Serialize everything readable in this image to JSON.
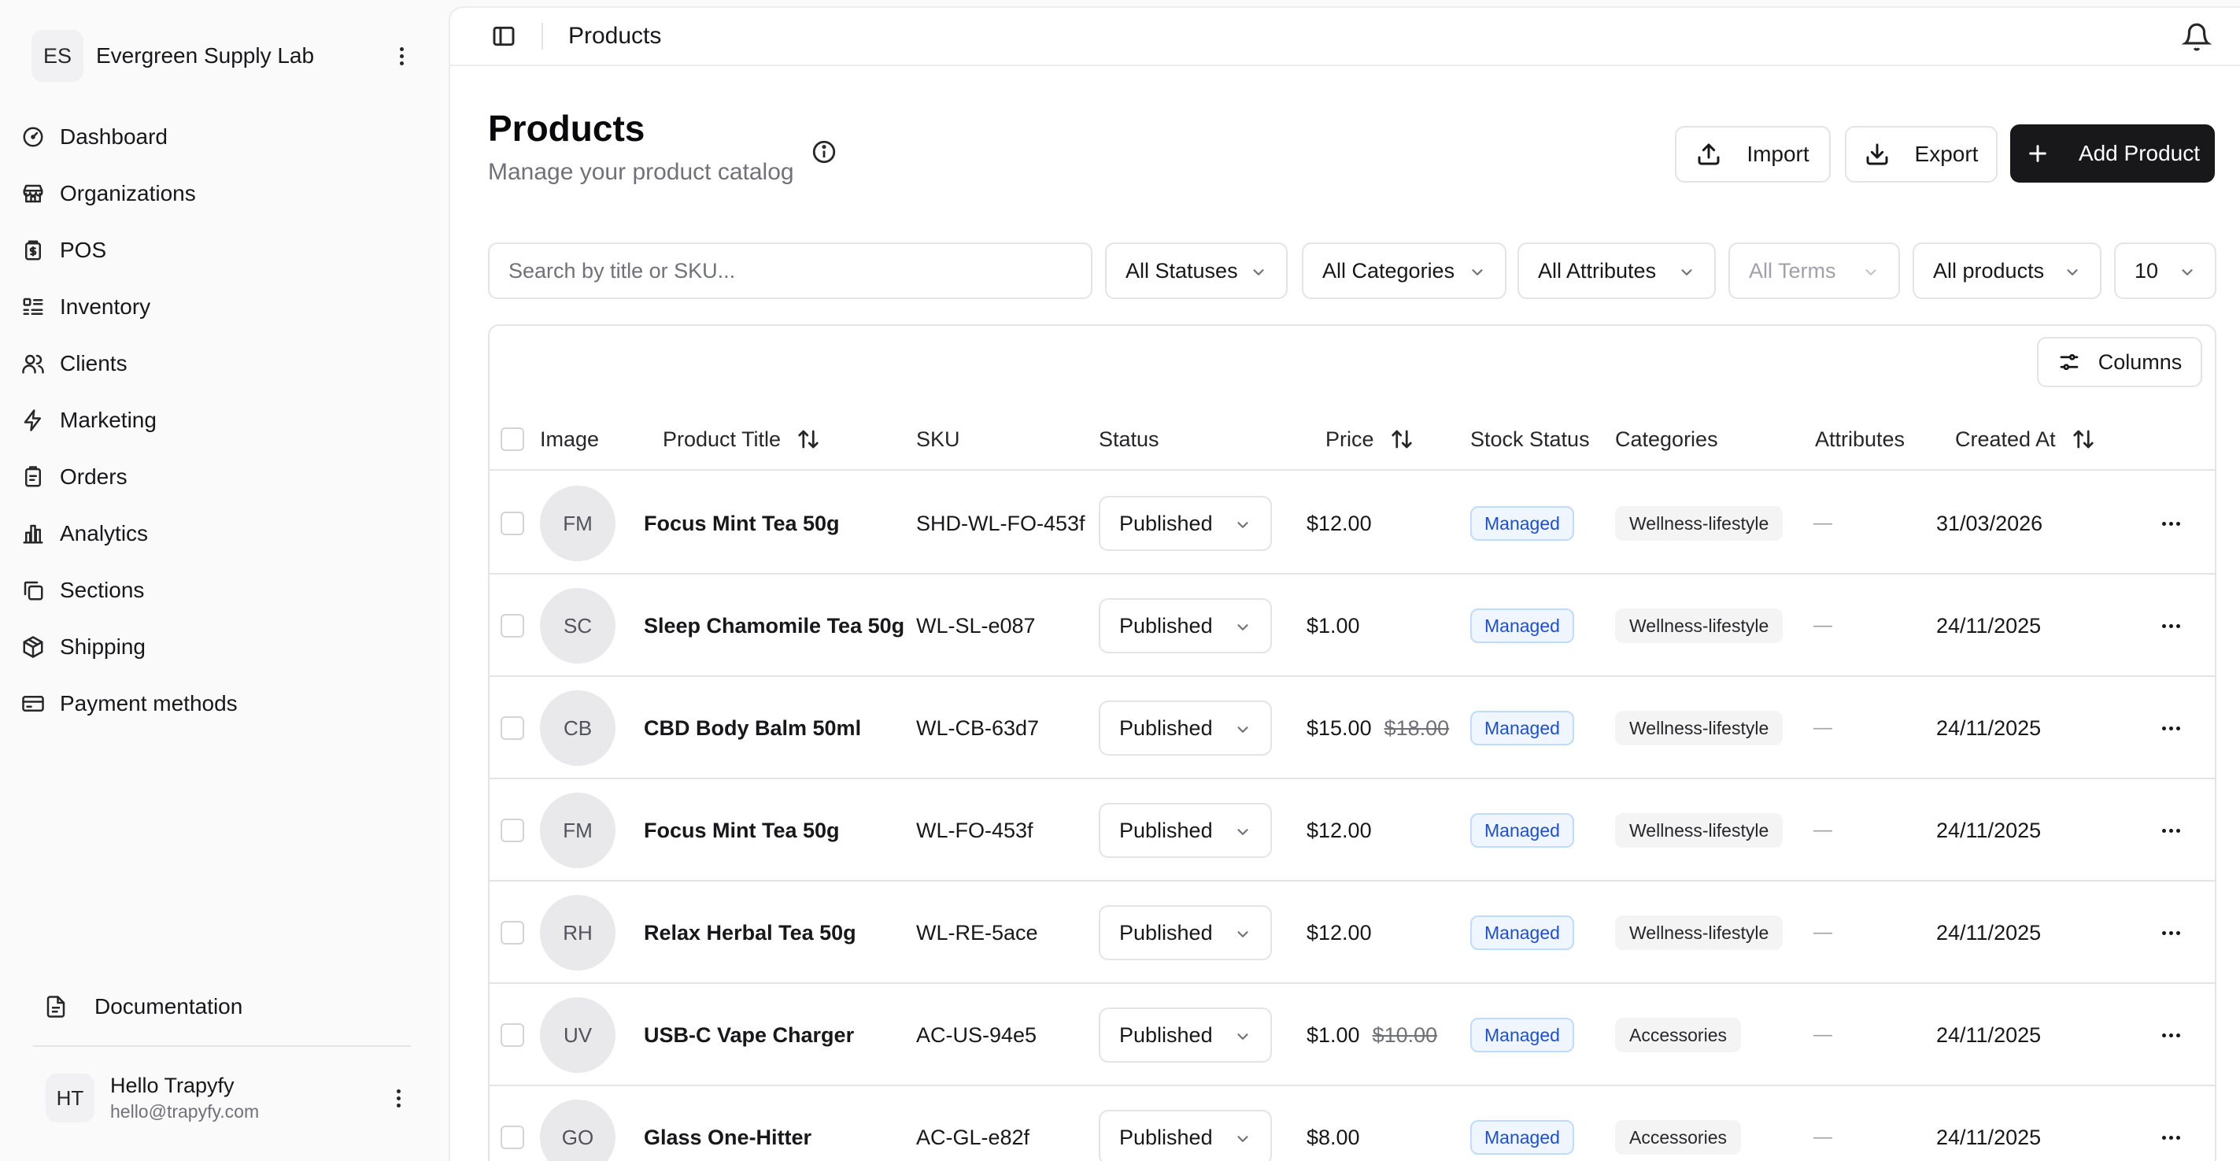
{
  "org": {
    "initials": "ES",
    "name": "Evergreen Supply Lab"
  },
  "sidebar": {
    "items": [
      {
        "label": "Dashboard",
        "icon": "gauge-icon"
      },
      {
        "label": "Organizations",
        "icon": "store-icon"
      },
      {
        "label": "POS",
        "icon": "receipt-icon"
      },
      {
        "label": "Inventory",
        "icon": "list-icon"
      },
      {
        "label": "Clients",
        "icon": "users-icon"
      },
      {
        "label": "Marketing",
        "icon": "zap-icon"
      },
      {
        "label": "Orders",
        "icon": "clipboard-icon"
      },
      {
        "label": "Analytics",
        "icon": "bar-chart-icon"
      },
      {
        "label": "Sections",
        "icon": "copy-icon"
      },
      {
        "label": "Shipping",
        "icon": "package-icon"
      },
      {
        "label": "Payment methods",
        "icon": "credit-card-icon"
      }
    ],
    "documentation": "Documentation",
    "user": {
      "initials": "HT",
      "name": "Hello Trapyfy",
      "email": "hello@trapyfy.com"
    }
  },
  "topbar": {
    "title": "Products"
  },
  "page": {
    "title": "Products",
    "subtitle": "Manage your product catalog",
    "import_label": "Import",
    "export_label": "Export",
    "add_label": "Add Product"
  },
  "filters": {
    "search_placeholder": "Search by title or SKU...",
    "status": "All Statuses",
    "categories": "All Categories",
    "attributes": "All Attributes",
    "terms": "All Terms",
    "products": "All products",
    "page_size": "10"
  },
  "table": {
    "columns_label": "Columns",
    "headers": {
      "image": "Image",
      "title": "Product Title",
      "sku": "SKU",
      "status": "Status",
      "price": "Price",
      "stock": "Stock Status",
      "categories": "Categories",
      "attributes": "Attributes",
      "created": "Created At"
    },
    "rows": [
      {
        "initials": "FM",
        "title": "Focus Mint Tea 50g",
        "sku": "SHD-WL-FO-453f",
        "status": "Published",
        "price": "$12.00",
        "old_price": "",
        "stock": "Managed",
        "category": "Wellness-lifestyle",
        "attributes": "—",
        "created": "31/03/2026"
      },
      {
        "initials": "SC",
        "title": "Sleep Chamomile Tea 50g",
        "sku": "WL-SL-e087",
        "status": "Published",
        "price": "$1.00",
        "old_price": "",
        "stock": "Managed",
        "category": "Wellness-lifestyle",
        "attributes": "—",
        "created": "24/11/2025"
      },
      {
        "initials": "CB",
        "title": "CBD Body Balm 50ml",
        "sku": "WL-CB-63d7",
        "status": "Published",
        "price": "$15.00",
        "old_price": "$18.00",
        "stock": "Managed",
        "category": "Wellness-lifestyle",
        "attributes": "—",
        "created": "24/11/2025"
      },
      {
        "initials": "FM",
        "title": "Focus Mint Tea 50g",
        "sku": "WL-FO-453f",
        "status": "Published",
        "price": "$12.00",
        "old_price": "",
        "stock": "Managed",
        "category": "Wellness-lifestyle",
        "attributes": "—",
        "created": "24/11/2025"
      },
      {
        "initials": "RH",
        "title": "Relax Herbal Tea 50g",
        "sku": "WL-RE-5ace",
        "status": "Published",
        "price": "$12.00",
        "old_price": "",
        "stock": "Managed",
        "category": "Wellness-lifestyle",
        "attributes": "—",
        "created": "24/11/2025"
      },
      {
        "initials": "UV",
        "title": "USB-C Vape Charger",
        "sku": "AC-US-94e5",
        "status": "Published",
        "price": "$1.00",
        "old_price": "$10.00",
        "stock": "Managed",
        "category": "Accessories",
        "attributes": "—",
        "created": "24/11/2025"
      },
      {
        "initials": "GO",
        "title": "Glass One-Hitter",
        "sku": "AC-GL-e82f",
        "status": "Published",
        "price": "$8.00",
        "old_price": "",
        "stock": "Managed",
        "category": "Accessories",
        "attributes": "—",
        "created": "24/11/2025"
      }
    ]
  },
  "colors": {
    "accent": "#18181b",
    "managed_badge": "#1d4ed8",
    "muted_text": "#71717a"
  }
}
